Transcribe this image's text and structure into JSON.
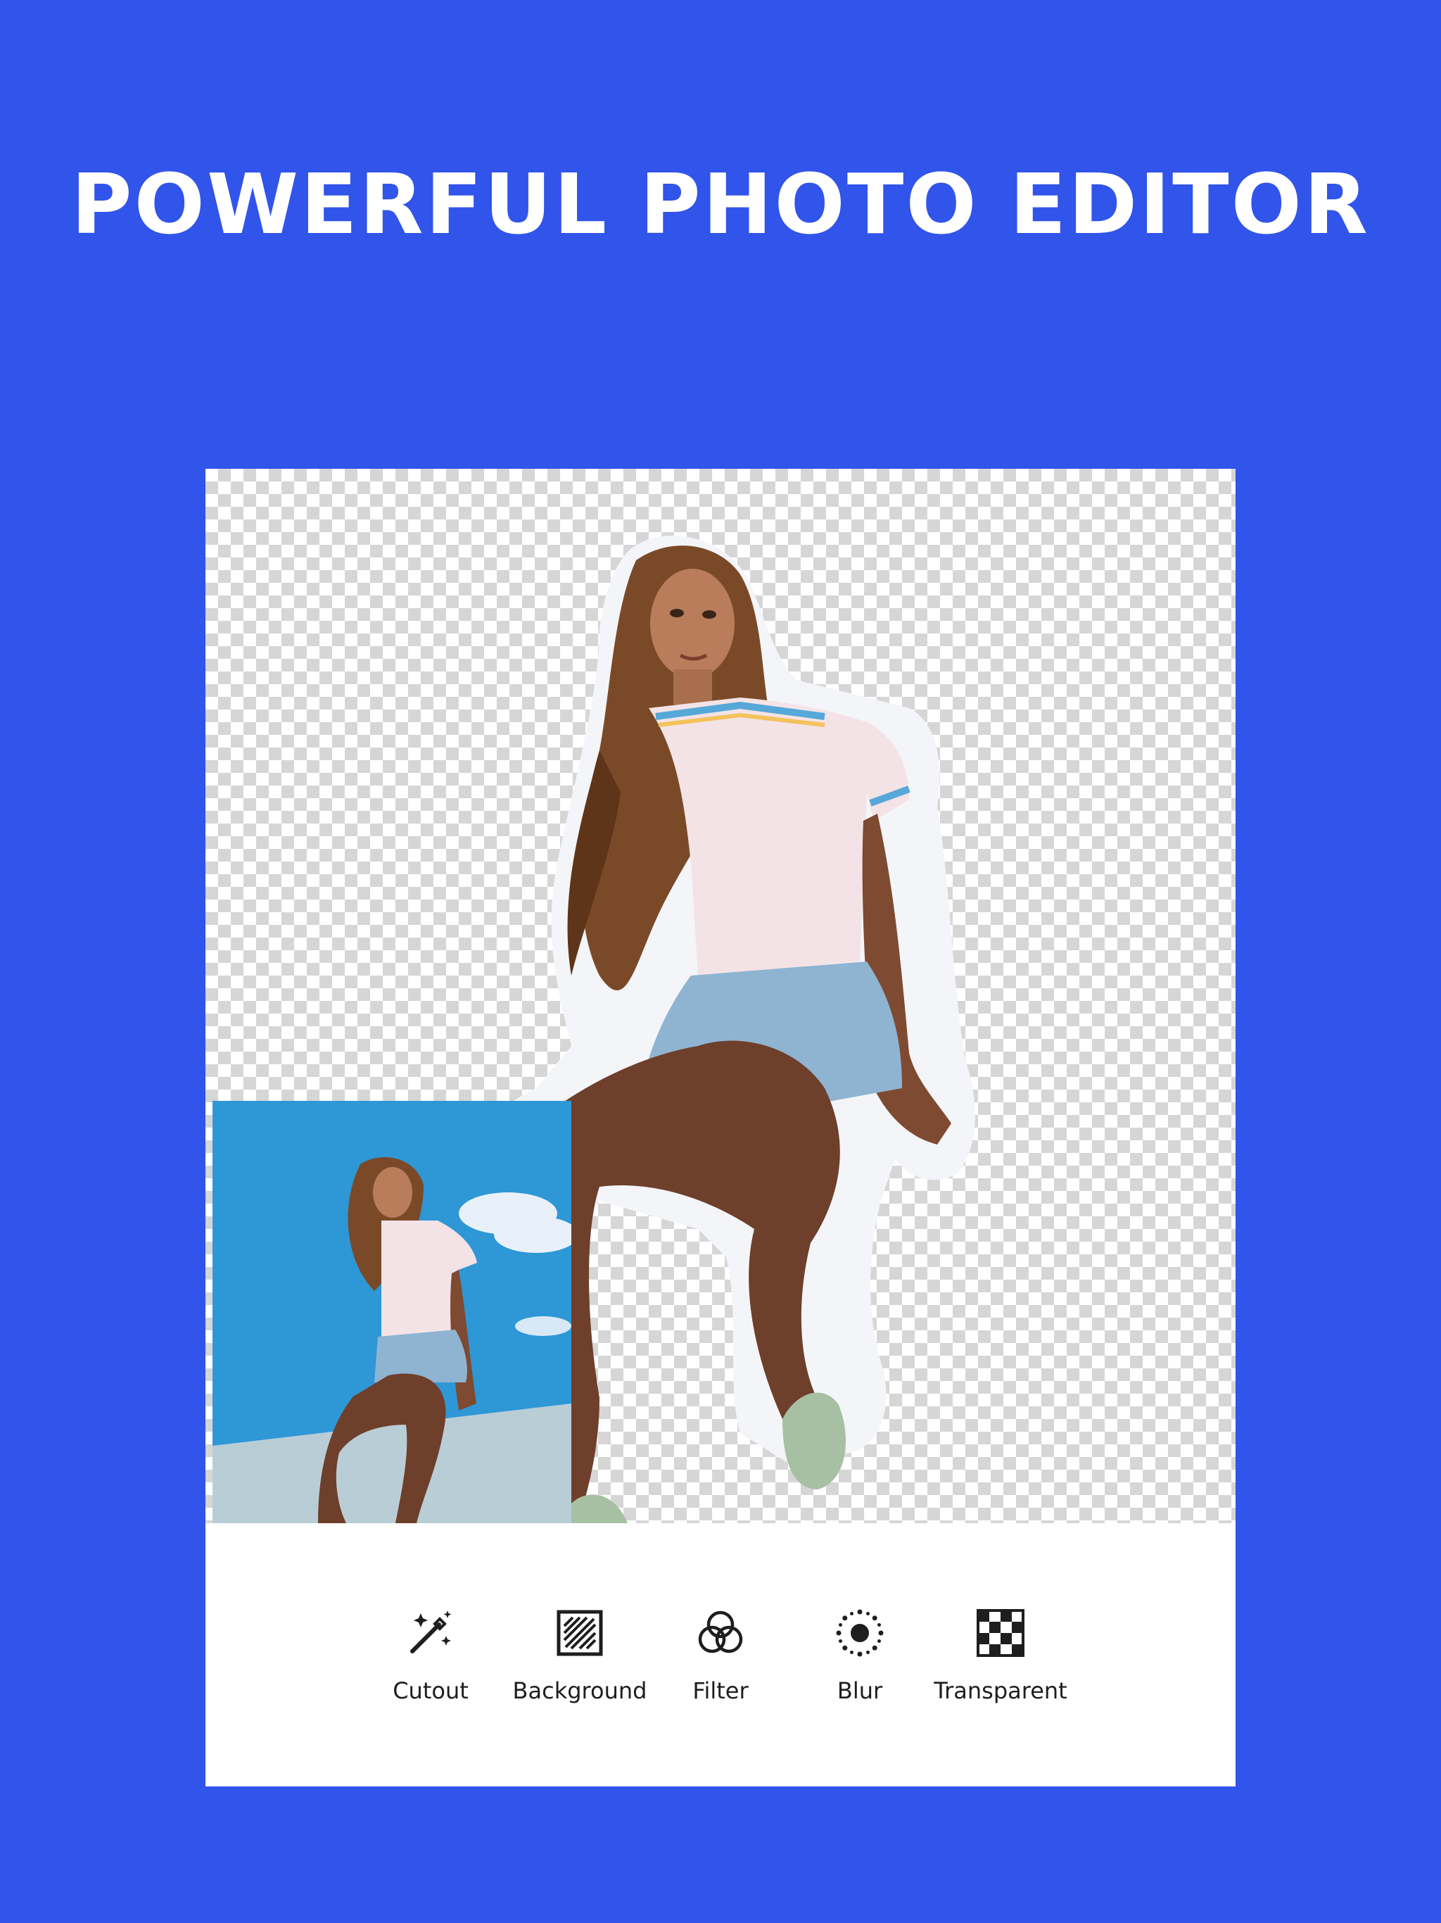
{
  "headline": "POWERFUL PHOTO EDITOR",
  "colors": {
    "background": "#3154EA",
    "card": "#FFFFFF",
    "checker": "#D6D6D6",
    "icon": "#1E1E1E"
  },
  "editor": {
    "canvas_background": "transparent-checkerboard",
    "original_thumbnail": "original-photo"
  },
  "toolbar": {
    "tools": [
      {
        "label": "Cutout",
        "icon": "magic-wand-icon"
      },
      {
        "label": "Background",
        "icon": "background-hatch-icon"
      },
      {
        "label": "Filter",
        "icon": "filter-circles-icon"
      },
      {
        "label": "Blur",
        "icon": "blur-icon"
      },
      {
        "label": "Transparent",
        "icon": "checkerboard-icon"
      }
    ]
  }
}
